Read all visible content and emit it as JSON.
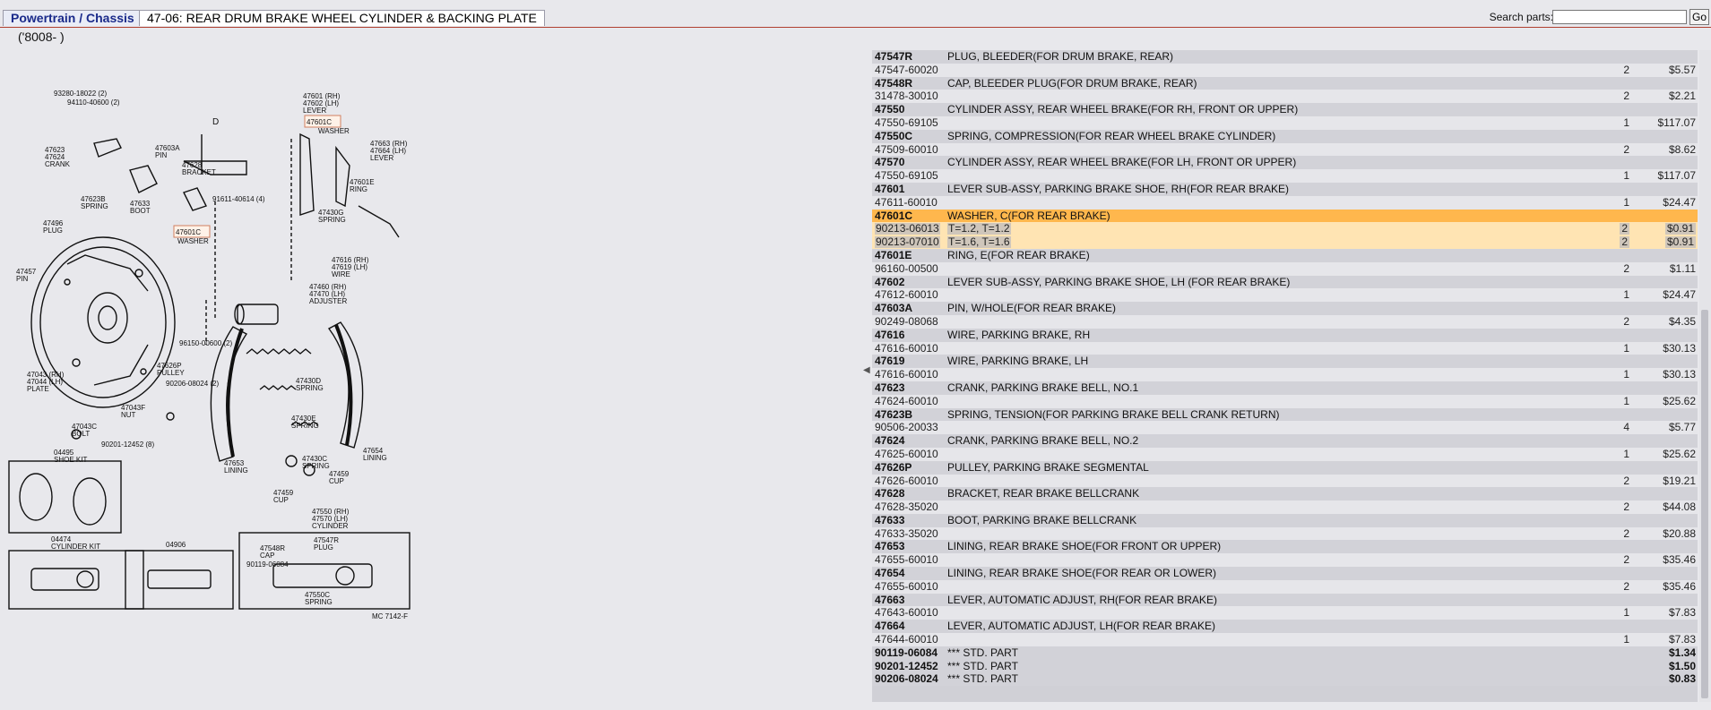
{
  "header": {
    "breadcrumb": "Powertrain / Chassis",
    "page_title": "47-06: REAR DRUM BRAKE WHEEL CYLINDER & BACKING PLATE",
    "search_label": "Search parts:",
    "search_value": "",
    "go_label": "Go"
  },
  "model_note": "('8008-      )",
  "diagram": {
    "labels": {
      "l1": "93280-18022 (2)",
      "l2": "94110-40600 (2)",
      "l3": "47623",
      "l4": "47624",
      "l5": "CRANK",
      "l6": "47603A",
      "l7": "PIN",
      "l8": "47628",
      "l9": "BRACKET",
      "l10": "47623B",
      "l11": "SPRING",
      "l12": "47633",
      "l13": "BOOT",
      "l14": "91611-40614 (4)",
      "l15": "47496",
      "l16": "PLUG",
      "l17": "47601C",
      "l18": "WASHER",
      "l19": "47457",
      "l20": "PIN",
      "l21": "47601 (RH)",
      "l22": "47602 (LH)",
      "l23": "LEVER",
      "l24": "47601C",
      "l25": "WASHER",
      "l26": "47663 (RH)",
      "l27": "47664 (LH)",
      "l28": "LEVER",
      "l29": "47601E",
      "l30": "RING",
      "l31": "47430G",
      "l32": "SPRING",
      "l33": "47616 (RH)",
      "l34": "47619 (LH)",
      "l35": "WIRE",
      "l36": "47460 (RH)",
      "l37": "47470 (LH)",
      "l38": "ADJUSTER",
      "l39": "96150-00600 (2)",
      "l40": "47626P",
      "l41": "PULLEY",
      "l42": "90206-08024 (2)",
      "l43": "47043 (RH)",
      "l44": "47044 (LH)",
      "l45": "PLATE",
      "l46": "47430D",
      "l47": "SPRING",
      "l48": "47043F",
      "l49": "NUT",
      "l50": "47043C",
      "l51": "BOLT",
      "l52": "90201-12452 (8)",
      "l53": "47430E",
      "l54": "SPRING",
      "l55": "47654",
      "l56": "LINING",
      "l57": "47653",
      "l58": "LINING",
      "l59": "47430C",
      "l60": "SPRING",
      "l61": "47459",
      "l62": "CUP",
      "l63": "47459",
      "l64": "CUP",
      "l65": "47550 (RH)",
      "l66": "47570 (LH)",
      "l67": "CYLINDER",
      "l68": "04495",
      "l69": "SHOE KIT",
      "l70": "04474",
      "l71": "CYLINDER KIT",
      "l72": "04906",
      "l73": "47548R",
      "l74": "CAP",
      "l75": "47547R",
      "l76": "PLUG",
      "l77": "90119-06084",
      "l78": "47550C",
      "l79": "SPRING",
      "l80": "MC 7142-F",
      "l81": "D"
    }
  },
  "parts": [
    {
      "pn": "47547R",
      "desc": "PLUG, BLEEDER(FOR DRUM BRAKE, REAR)",
      "subs": [
        {
          "pn": "47547-60020",
          "desc": "",
          "qty": "2",
          "price": "$5.57"
        }
      ]
    },
    {
      "pn": "47548R",
      "desc": "CAP, BLEEDER PLUG(FOR DRUM BRAKE, REAR)",
      "subs": [
        {
          "pn": "31478-30010",
          "desc": "",
          "qty": "2",
          "price": "$2.21"
        }
      ]
    },
    {
      "pn": "47550",
      "desc": "CYLINDER ASSY, REAR WHEEL BRAKE(FOR RH, FRONT OR UPPER)",
      "subs": [
        {
          "pn": "47550-69105",
          "desc": "",
          "qty": "1",
          "price": "$117.07"
        }
      ]
    },
    {
      "pn": "47550C",
      "desc": "SPRING, COMPRESSION(FOR REAR WHEEL BRAKE CYLINDER)",
      "subs": [
        {
          "pn": "47509-60010",
          "desc": "",
          "qty": "2",
          "price": "$8.62"
        }
      ]
    },
    {
      "pn": "47570",
      "desc": "CYLINDER ASSY, REAR WHEEL BRAKE(FOR LH, FRONT OR UPPER)",
      "subs": [
        {
          "pn": "47550-69105",
          "desc": "",
          "qty": "1",
          "price": "$117.07"
        }
      ]
    },
    {
      "pn": "47601",
      "desc": "LEVER SUB-ASSY, PARKING BRAKE SHOE, RH(FOR REAR BRAKE)",
      "subs": [
        {
          "pn": "47611-60010",
          "desc": "",
          "qty": "1",
          "price": "$24.47"
        }
      ]
    },
    {
      "pn": "47601C",
      "desc": "WASHER, C(FOR REAR BRAKE)",
      "highlight": true,
      "subs": [
        {
          "pn": "90213-06013",
          "desc": "T=1.2, T=1.2",
          "qty": "2",
          "price": "$0.91"
        },
        {
          "pn": "90213-07010",
          "desc": "T=1.6, T=1.6",
          "qty": "2",
          "price": "$0.91"
        }
      ]
    },
    {
      "pn": "47601E",
      "desc": "RING, E(FOR REAR BRAKE)",
      "subs": [
        {
          "pn": "96160-00500",
          "desc": "",
          "qty": "2",
          "price": "$1.11"
        }
      ]
    },
    {
      "pn": "47602",
      "desc": "LEVER SUB-ASSY, PARKING BRAKE SHOE, LH (FOR REAR BRAKE)",
      "subs": [
        {
          "pn": "47612-60010",
          "desc": "",
          "qty": "1",
          "price": "$24.47"
        }
      ]
    },
    {
      "pn": "47603A",
      "desc": "PIN, W/HOLE(FOR REAR BRAKE)",
      "subs": [
        {
          "pn": "90249-08068",
          "desc": "",
          "qty": "2",
          "price": "$4.35"
        }
      ]
    },
    {
      "pn": "47616",
      "desc": "WIRE, PARKING BRAKE, RH",
      "subs": [
        {
          "pn": "47616-60010",
          "desc": "",
          "qty": "1",
          "price": "$30.13"
        }
      ]
    },
    {
      "pn": "47619",
      "desc": "WIRE, PARKING BRAKE, LH",
      "subs": [
        {
          "pn": "47616-60010",
          "desc": "",
          "qty": "1",
          "price": "$30.13"
        }
      ]
    },
    {
      "pn": "47623",
      "desc": "CRANK, PARKING BRAKE BELL, NO.1",
      "subs": [
        {
          "pn": "47624-60010",
          "desc": "",
          "qty": "1",
          "price": "$25.62"
        }
      ]
    },
    {
      "pn": "47623B",
      "desc": "SPRING, TENSION(FOR PARKING BRAKE BELL CRANK RETURN)",
      "subs": [
        {
          "pn": "90506-20033",
          "desc": "",
          "qty": "4",
          "price": "$5.77"
        }
      ]
    },
    {
      "pn": "47624",
      "desc": "CRANK, PARKING BRAKE BELL, NO.2",
      "subs": [
        {
          "pn": "47625-60010",
          "desc": "",
          "qty": "1",
          "price": "$25.62"
        }
      ]
    },
    {
      "pn": "47626P",
      "desc": "PULLEY, PARKING BRAKE SEGMENTAL",
      "subs": [
        {
          "pn": "47626-60010",
          "desc": "",
          "qty": "2",
          "price": "$19.21"
        }
      ]
    },
    {
      "pn": "47628",
      "desc": "BRACKET, REAR BRAKE BELLCRANK",
      "subs": [
        {
          "pn": "47628-35020",
          "desc": "",
          "qty": "2",
          "price": "$44.08"
        }
      ]
    },
    {
      "pn": "47633",
      "desc": "BOOT, PARKING BRAKE BELLCRANK",
      "subs": [
        {
          "pn": "47633-35020",
          "desc": "",
          "qty": "2",
          "price": "$20.88"
        }
      ]
    },
    {
      "pn": "47653",
      "desc": "LINING, REAR BRAKE SHOE(FOR FRONT OR UPPER)",
      "subs": [
        {
          "pn": "47655-60010",
          "desc": "",
          "qty": "2",
          "price": "$35.46"
        }
      ]
    },
    {
      "pn": "47654",
      "desc": "LINING, REAR BRAKE SHOE(FOR REAR OR LOWER)",
      "subs": [
        {
          "pn": "47655-60010",
          "desc": "",
          "qty": "2",
          "price": "$35.46"
        }
      ]
    },
    {
      "pn": "47663",
      "desc": "LEVER, AUTOMATIC ADJUST, RH(FOR REAR BRAKE)",
      "subs": [
        {
          "pn": "47643-60010",
          "desc": "",
          "qty": "1",
          "price": "$7.83"
        }
      ]
    },
    {
      "pn": "47664",
      "desc": "LEVER, AUTOMATIC ADJUST, LH(FOR REAR BRAKE)",
      "subs": [
        {
          "pn": "47644-60010",
          "desc": "",
          "qty": "1",
          "price": "$7.83"
        }
      ]
    }
  ],
  "std_parts": [
    {
      "pn": "90119-06084",
      "desc": "*** STD. PART",
      "price": "$1.34"
    },
    {
      "pn": "90201-12452",
      "desc": "*** STD. PART",
      "price": "$1.50"
    },
    {
      "pn": "90206-08024",
      "desc": "*** STD. PART",
      "price": "$0.83"
    }
  ],
  "colors": {
    "highlight": "#ffb74d",
    "highlight_sub": "#ffe4b3",
    "breadcrumb": "#1a2a8a",
    "accent_line": "#b04030"
  }
}
